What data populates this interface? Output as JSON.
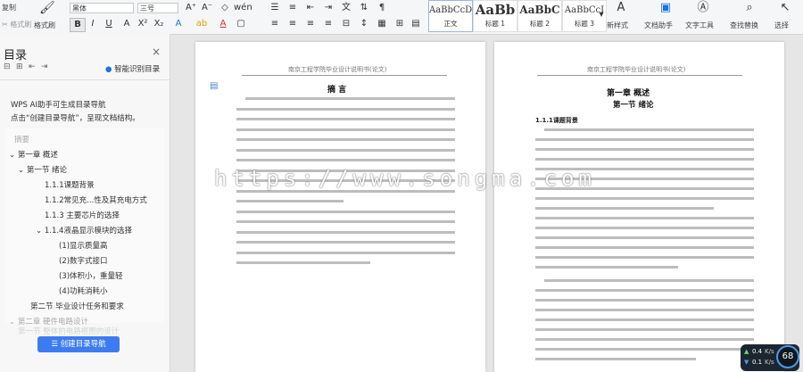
{
  "ribbon": {
    "paste_top": "复制",
    "paste_bottom": "格式刷",
    "format_painter": "格式刷",
    "font_name": "黑体",
    "font_size": "三号",
    "styles": [
      {
        "sample": "AaBbCcDd",
        "name": "正文"
      },
      {
        "sample": "AaBb",
        "name": "标题 1"
      },
      {
        "sample": "AaBbC",
        "name": "标题 2"
      },
      {
        "sample": "AaBbCcI",
        "name": "标题 3"
      }
    ],
    "new_style": "新样式",
    "doc_assistant": "文档助手",
    "text_tools": "文字工具",
    "find_replace": "查找替换",
    "select": "选择"
  },
  "sidebar": {
    "title": "目录",
    "smart_toc": "智能识别目录",
    "wps_ai_line1": "WPS AI助手可生成目录导航",
    "wps_ai_line2": "点击“创建目录导航”，呈现文档结构。",
    "items": [
      {
        "label": "摘要",
        "grey": true
      },
      {
        "label": "第一章   概述",
        "grey": false
      },
      {
        "label": "第一节   绪论",
        "grey": false
      },
      {
        "label": "1.1.1课题背景",
        "grey": false
      },
      {
        "label": "1.1.2常见充...性及其充电方式",
        "grey": false
      },
      {
        "label": "1.1.3 主要芯片的选择",
        "grey": false
      },
      {
        "label": "1.1.4液晶显示模块的选择",
        "grey": false
      },
      {
        "label": "(1)显示质量高",
        "grey": false
      },
      {
        "label": "(2)数字式接口",
        "grey": false
      },
      {
        "label": "(3)体积小，重量轻",
        "grey": false
      },
      {
        "label": "(4)功耗消耗小",
        "grey": false
      },
      {
        "label": "第二节   毕业设计任务和要求",
        "grey": false
      },
      {
        "label": "第二章   硬件电路设计",
        "grey": true
      },
      {
        "label": "第一节   整体的电路框图的设计",
        "grey": true
      }
    ],
    "create_button": "创建目录导航"
  },
  "page_left": {
    "header": "南京工程学院毕业设计说明书(论文)",
    "title": "摘  言"
  },
  "page_right": {
    "header": "南京工程学院毕业设计说明书(论文)",
    "chapter": "第一章   概述",
    "section": "第一节   绪论",
    "subsection": "1.1.1课题背景"
  },
  "watermark": "https://www.songma.com",
  "status": {
    "net_up": "0.4",
    "net_up_unit": "K/s",
    "net_down": "0.1",
    "net_down_unit": "K/s",
    "cpu": "68"
  }
}
